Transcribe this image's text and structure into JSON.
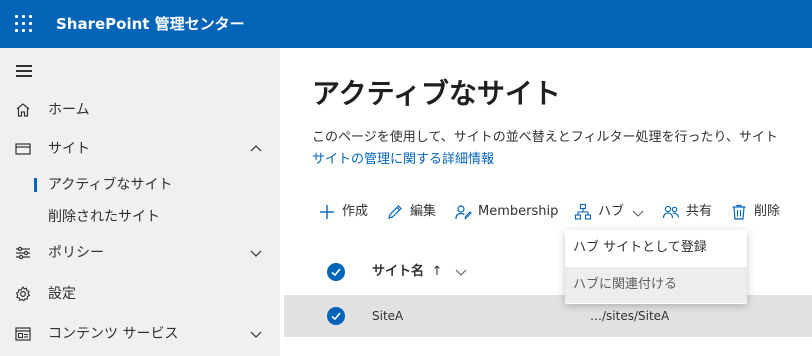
{
  "app": {
    "title": "SharePoint 管理センター"
  },
  "nav": {
    "items": [
      {
        "label": "ホーム",
        "icon": "home-icon"
      },
      {
        "label": "サイト",
        "icon": "sites-icon",
        "expanded": true,
        "children": [
          {
            "label": "アクティブなサイト",
            "active": true
          },
          {
            "label": "削除されたサイト",
            "active": false
          }
        ]
      },
      {
        "label": "ポリシー",
        "icon": "policies-icon",
        "expanded": false
      },
      {
        "label": "設定",
        "icon": "settings-icon"
      },
      {
        "label": "コンテンツ サービス",
        "icon": "content-services-icon",
        "expanded": false
      }
    ]
  },
  "page": {
    "title": "アクティブなサイト",
    "description": "このページを使用して、サイトの並べ替えとフィルター処理を行ったり、サイト",
    "link": "サイトの管理に関する詳細情報"
  },
  "commands": [
    {
      "label": "作成",
      "icon": "plus-icon"
    },
    {
      "label": "編集",
      "icon": "edit-icon"
    },
    {
      "label": "Membership",
      "icon": "membership-icon"
    },
    {
      "label": "ハブ",
      "icon": "hub-icon",
      "dropdown": true
    },
    {
      "label": "共有",
      "icon": "share-icon"
    },
    {
      "label": "削除",
      "icon": "delete-icon"
    }
  ],
  "table": {
    "column_name": "サイト名",
    "sort_indicator": "↑",
    "rows": [
      {
        "name": "SiteA",
        "url": "…/sites/SiteA",
        "selected": true
      }
    ]
  },
  "hub_menu": {
    "items": [
      {
        "label": "ハブ サイトとして登録",
        "hover": false
      },
      {
        "label": "ハブに関連付ける",
        "hover": true
      }
    ]
  },
  "colors": {
    "brand": "#0364b8",
    "nav_bg": "#f0f0f0",
    "selected_row": "#e1e1e1"
  }
}
